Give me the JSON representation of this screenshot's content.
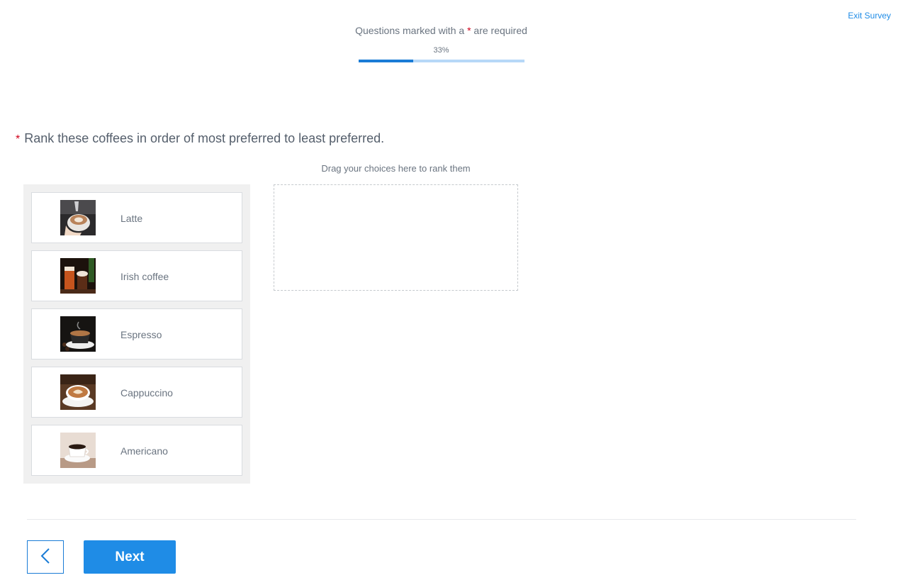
{
  "header": {
    "exit_label": "Exit Survey",
    "required_note_before": "Questions marked with a ",
    "required_star": "*",
    "required_note_after": " are required",
    "progress_label": "33%",
    "progress_fraction": 0.33
  },
  "question": {
    "required_star": "*",
    "text": "Rank these coffees in order of most preferred to least preferred.",
    "drop_hint": "Drag your choices here to rank them"
  },
  "choices": [
    {
      "label": "Latte",
      "icon": "latte-photo"
    },
    {
      "label": "Irish coffee",
      "icon": "irish-coffee-photo"
    },
    {
      "label": "Espresso",
      "icon": "espresso-photo"
    },
    {
      "label": "Cappuccino",
      "icon": "cappuccino-photo"
    },
    {
      "label": "Americano",
      "icon": "americano-photo"
    }
  ],
  "footer": {
    "back_icon": "chevron-left-icon",
    "next_label": "Next"
  },
  "colors": {
    "accent": "#1f8ce6",
    "progress_fill": "#1a7cd6",
    "progress_track": "#b7d8f7",
    "required": "#d0021b"
  }
}
